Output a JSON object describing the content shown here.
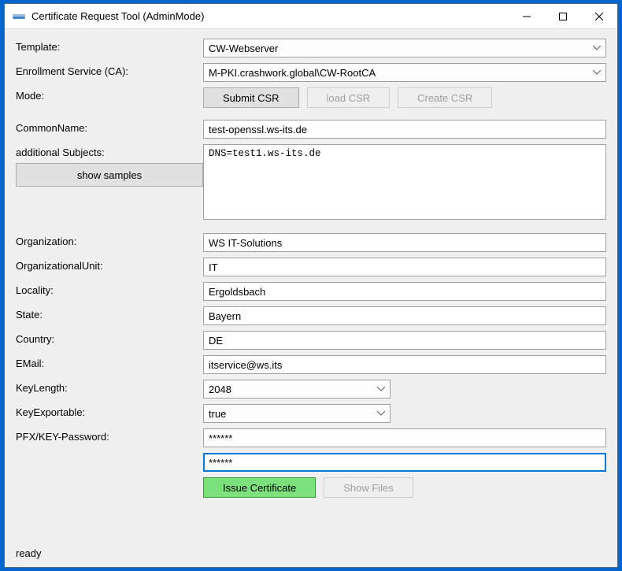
{
  "window": {
    "title": "Certificate Request Tool (AdminMode)"
  },
  "labels": {
    "template": "Template:",
    "enrollment": "Enrollment Service (CA):",
    "mode": "Mode:",
    "commonName": "CommonName:",
    "additionalSubjects": "additional Subjects:",
    "organization": "Organization:",
    "orgUnit": "OrganizationalUnit:",
    "locality": "Locality:",
    "state": "State:",
    "country": "Country:",
    "email": "EMail:",
    "keyLength": "KeyLength:",
    "keyExportable": "KeyExportable:",
    "pfxPassword": "PFX/KEY-Password:"
  },
  "buttons": {
    "submitCsr": "Submit CSR",
    "loadCsr": "load CSR",
    "createCsr": "Create CSR",
    "showSamples": "show samples",
    "issueCertificate": "Issue Certificate",
    "showFiles": "Show Files"
  },
  "values": {
    "template": "CW-Webserver",
    "enrollment": "M-PKI.crashwork.global\\CW-RootCA",
    "commonName": "test-openssl.ws-its.de",
    "additionalSubjects": "DNS=test1.ws-its.de",
    "organization": "WS IT-Solutions",
    "orgUnit": "IT",
    "locality": "Ergoldsbach",
    "state": "Bayern",
    "country": "DE",
    "email": "itservice@ws.its",
    "keyLength": "2048",
    "keyExportable": "true",
    "password1": "******",
    "password2": "******"
  },
  "status": "ready"
}
